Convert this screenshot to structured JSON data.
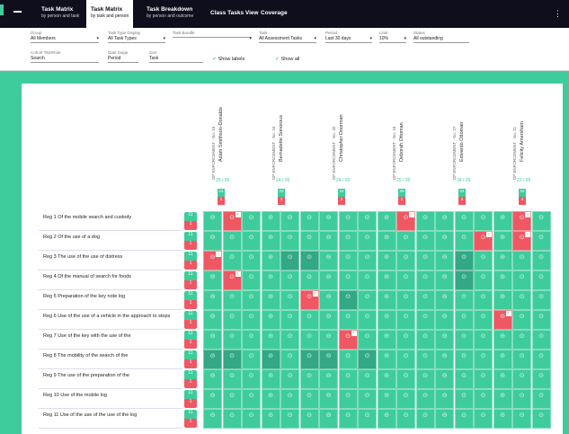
{
  "nav": {
    "tabs": [
      {
        "line1": "Task Matrix",
        "line2": "by person and task",
        "active": false
      },
      {
        "line1": "Task Matrix",
        "line2": "by task and person",
        "active": true
      },
      {
        "line1": "Task Breakdown",
        "line2": "by person and outcome",
        "active": false
      },
      {
        "line1": "Class Tasks View",
        "line2": "",
        "active": false
      },
      {
        "line1": "Coverage",
        "line2": "",
        "active": false
      }
    ]
  },
  "filters": {
    "group": {
      "label": "Group",
      "value": "All Members"
    },
    "task_type": {
      "label": "Task Type Display",
      "value": "All Task Types"
    },
    "task_bundle": {
      "label": "Task Bundle",
      "value": ""
    },
    "assessment": {
      "label": "Task",
      "value": "All Assessment Tasks"
    },
    "period": {
      "label": "Period",
      "value": "Last 30 days"
    },
    "limit": {
      "label": "Limit",
      "value": "10%"
    },
    "status": {
      "label": "Status",
      "value": "All outstanding"
    },
    "cohort": {
      "label": "Cohort Title/Role",
      "value": "Search"
    },
    "date_range": {
      "label": "Date range",
      "value": "Period"
    },
    "sort": {
      "label": "Sort",
      "value": "Task"
    },
    "show_labels": "Show labels",
    "show_all": "Show all"
  },
  "columns": [
    {
      "title": "Adam Smithson-Donalds",
      "subtitle": "DP ENFORCEMENT · No. 15",
      "ring": "25 / 26",
      "green": "24",
      "red": "2"
    },
    {
      "title": "Bernadette Sonorous",
      "subtitle": "DP ENFORCEMENT · No. 24",
      "ring": "24 / 26",
      "green": "23",
      "red": "3"
    },
    {
      "title": "Christopher Doorman",
      "subtitle": "DP ENFORCEMENT · No. 32",
      "ring": "24 / 26",
      "green": "24",
      "red": "2"
    },
    {
      "title": "Deborah Ottoman",
      "subtitle": "DP ENFORCEMENT · No. 18",
      "ring": "25 / 26",
      "green": "25",
      "red": "1"
    },
    {
      "title": "Edwardo Ottoman",
      "subtitle": "DP ENFORCEMENT · No. 27",
      "ring": "24 / 26",
      "green": "24",
      "red": "2"
    },
    {
      "title": "Felicity Amersham",
      "subtitle": "DP ENFORCEMENT · No. 11",
      "ring": "22 / 26",
      "green": "22",
      "red": "4"
    }
  ],
  "rows": [
    {
      "label": "Reg 1 Of the mobile search and custody",
      "green": "11",
      "red": "1"
    },
    {
      "label": "Reg 2 Of the use of a dog",
      "green": "11",
      "red": "1"
    },
    {
      "label": "Reg 3 The use of the use of distress",
      "green": "11",
      "red": "1"
    },
    {
      "label": "Reg 4 Of the manual of search for foods",
      "green": "11",
      "red": "1"
    },
    {
      "label": "Reg 5 Preparation of the key note log",
      "green": "11",
      "red": "1"
    },
    {
      "label": "Reg 6 Use of the use of a vehicle in the approach to stops",
      "green": "11",
      "red": "1"
    },
    {
      "label": "Reg 7 Use of the key with the use of the",
      "green": "11",
      "red": "1"
    },
    {
      "label": "Reg 8 The mobility of the search of the",
      "green": "11",
      "red": "1"
    },
    {
      "label": "Reg 9 The use of the preparation of the",
      "green": "11",
      "red": "1"
    },
    {
      "label": "Reg 10 Use of the mobile log",
      "green": "11",
      "red": "1"
    },
    {
      "label": "Reg 11 Use of the use of the use of the log",
      "green": "11",
      "red": "1"
    }
  ],
  "colors": {
    "accent": "#3fcc9c",
    "dark_cell": "#33a885",
    "alert": "#ee5863",
    "topbar": "#0e0e1c"
  },
  "icons": [
    "menu-icon",
    "more-icon",
    "check-icon",
    "person-icon"
  ]
}
